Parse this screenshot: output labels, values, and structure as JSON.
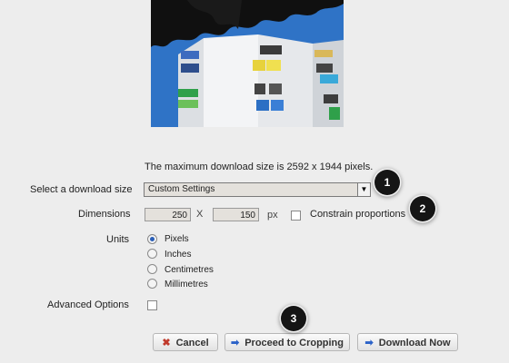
{
  "info": {
    "max_size_text": "The maximum download size is 2592 x 1944 pixels."
  },
  "download_size": {
    "label": "Select a download size",
    "selected": "Custom Settings"
  },
  "dimensions": {
    "label": "Dimensions",
    "width": "250",
    "separator": "X",
    "height": "150",
    "unit": "px",
    "constrain_label": "Constrain proportions",
    "constrain_checked": false
  },
  "units": {
    "label": "Units",
    "options": [
      "Pixels",
      "Inches",
      "Centimetres",
      "Millimetres"
    ],
    "selected": "Pixels"
  },
  "advanced": {
    "label": "Advanced Options",
    "checked": false
  },
  "buttons": {
    "cancel": "Cancel",
    "proceed": "Proceed to Cropping",
    "download": "Download Now"
  },
  "callouts": [
    "1",
    "2",
    "3"
  ],
  "icons": {
    "cancel": "close-icon",
    "proceed": "arrow-right-icon",
    "download": "arrow-right-icon",
    "select": "chevron-down-icon"
  },
  "colors": {
    "accent_blue": "#2b62c8",
    "cancel_red": "#c0392b",
    "badge": "#151515"
  }
}
